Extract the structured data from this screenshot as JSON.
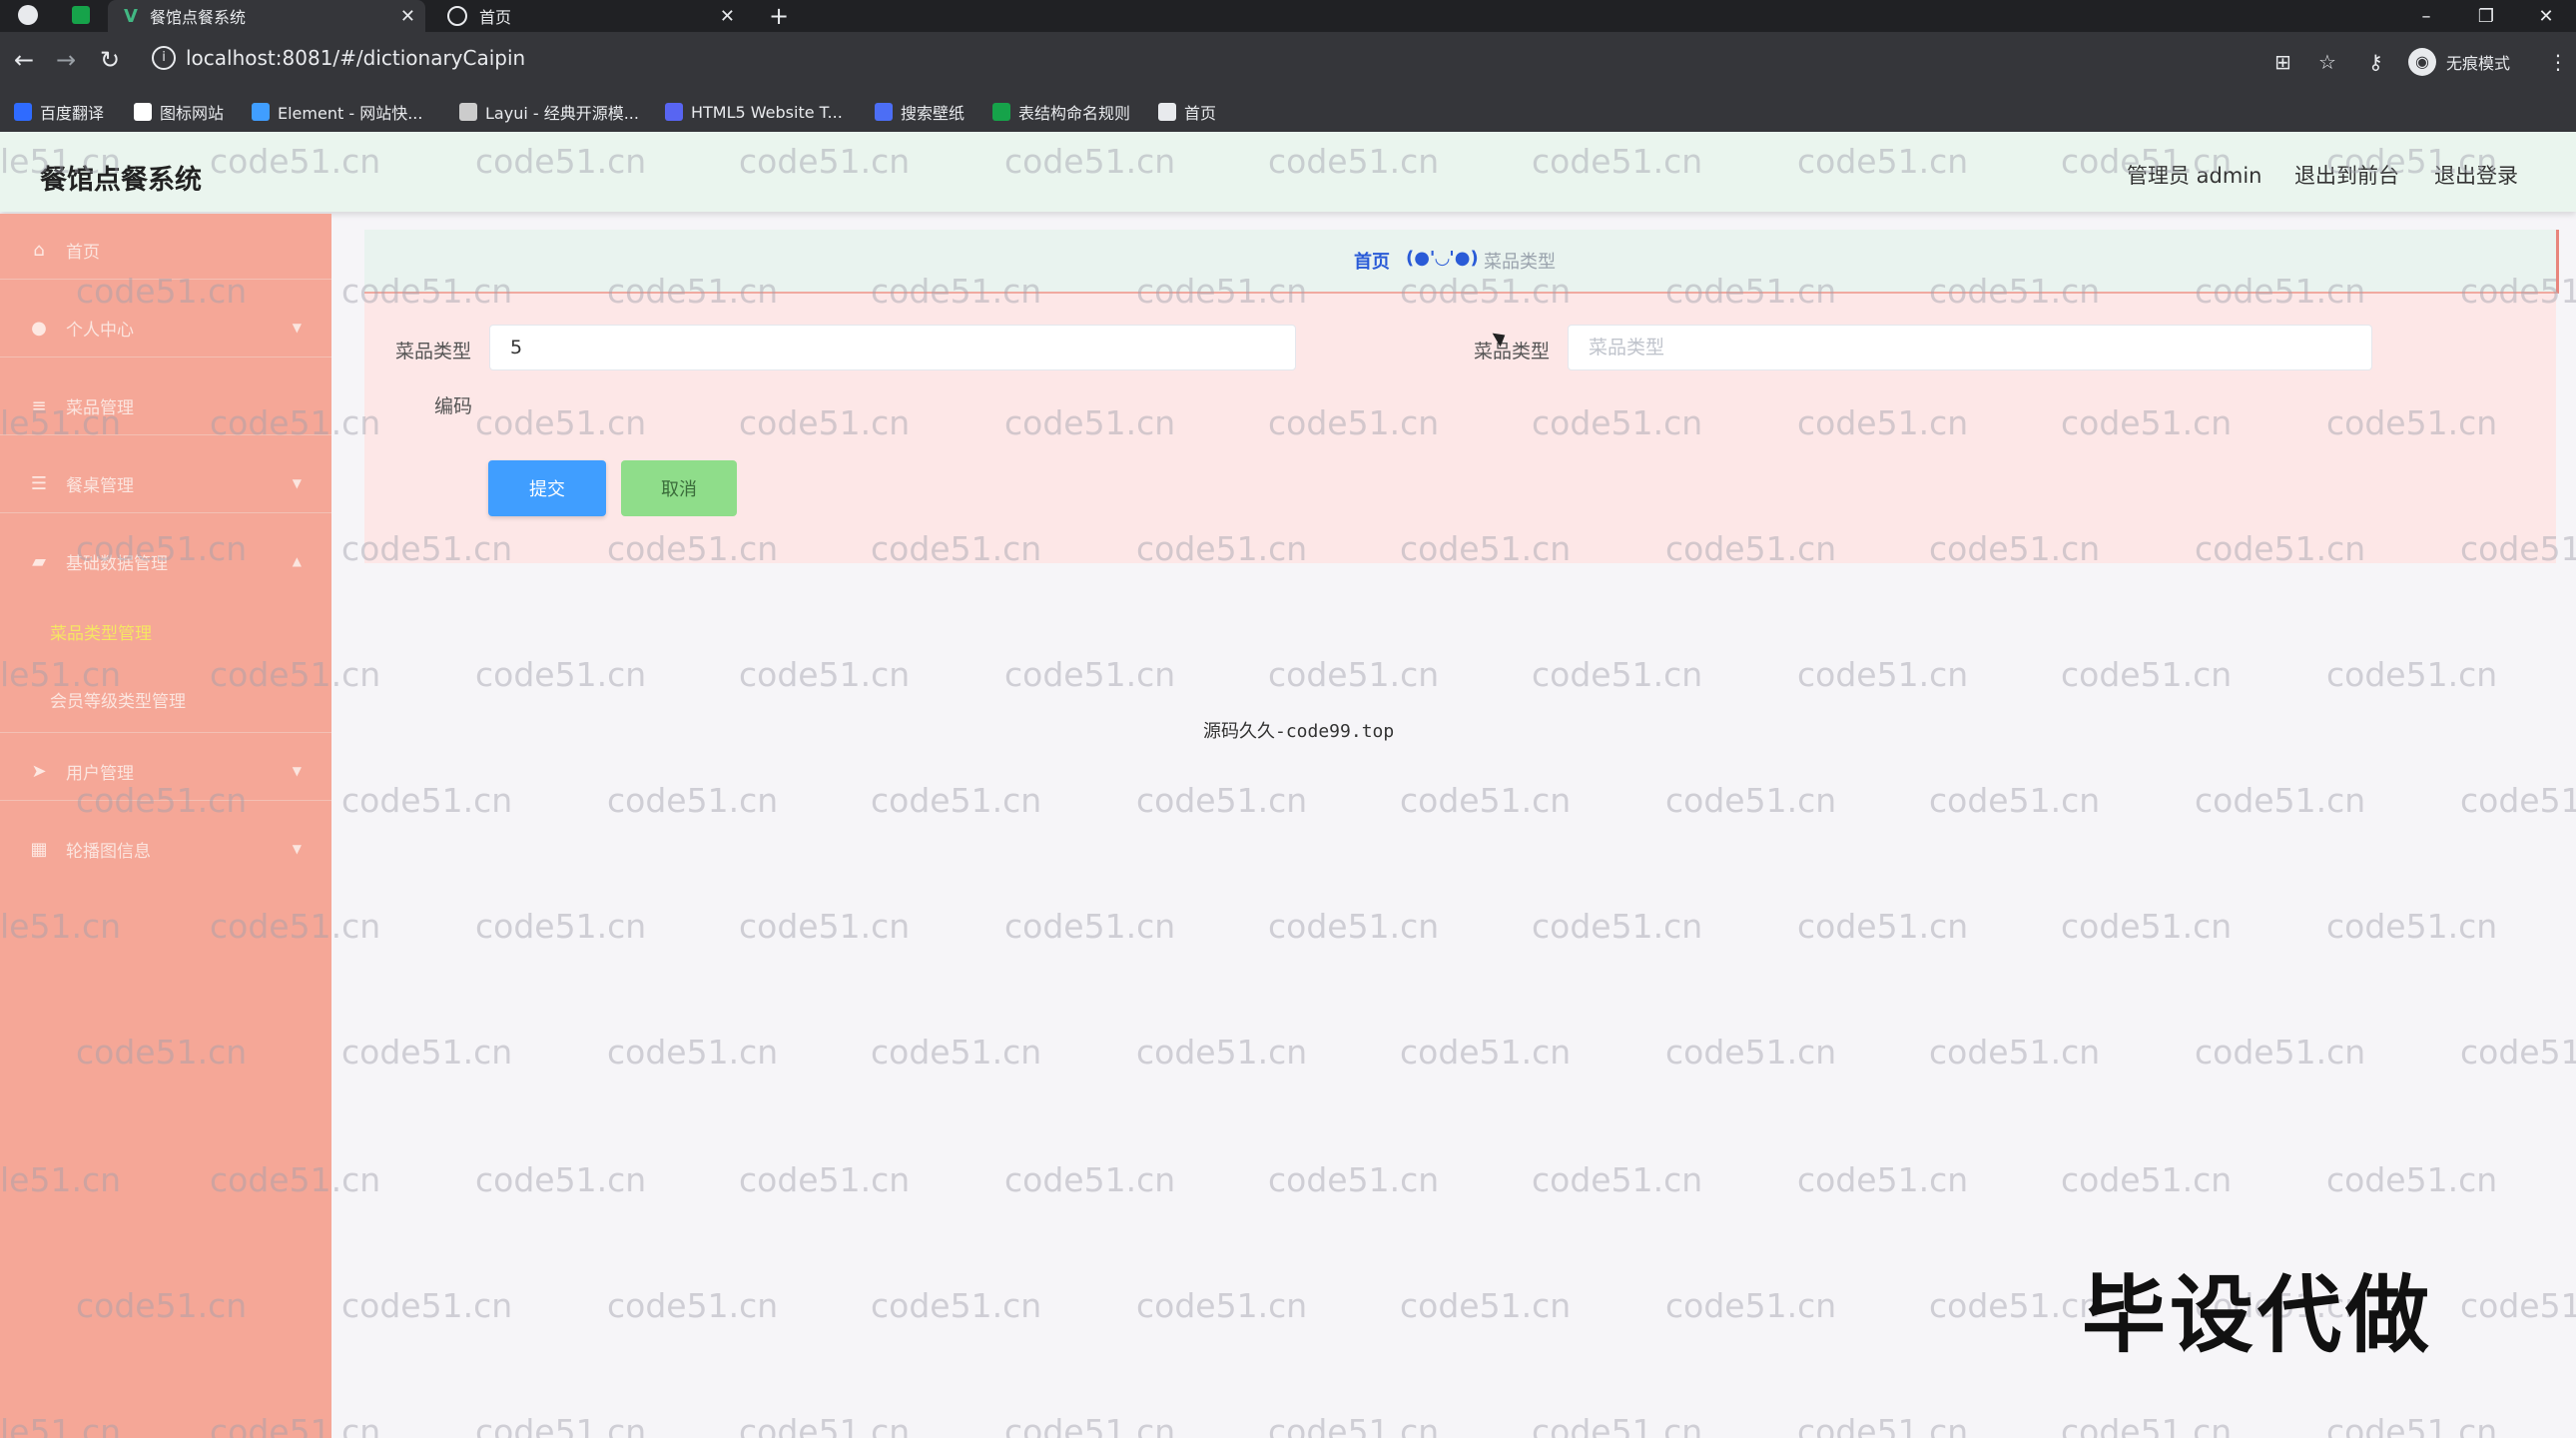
{
  "browser": {
    "tabs": [
      {
        "title": "餐馆点餐系统",
        "active": true
      },
      {
        "title": "首页",
        "active": false
      }
    ],
    "new_tab": "+",
    "url": "localhost:8081/#/dictionaryCaipin",
    "incognito_label": "无痕模式",
    "bookmarks": [
      {
        "label": "百度翻译",
        "color": "#2f6bff"
      },
      {
        "label": "图标网站",
        "color": "#ffffff"
      },
      {
        "label": "Element - 网站快...",
        "color": "#409eff"
      },
      {
        "label": "Layui - 经典开源模...",
        "color": "#cccccc"
      },
      {
        "label": "HTML5 Website T...",
        "color": "#5865f2"
      },
      {
        "label": "搜索壁纸",
        "color": "#4c6ef5"
      },
      {
        "label": "表结构命名规则",
        "color": "#16a34a"
      },
      {
        "label": "首页",
        "color": "#e8eaed"
      }
    ]
  },
  "header": {
    "app_title": "餐馆点餐系统",
    "admin_label": "管理员 admin",
    "to_front": "退出到前台",
    "logout": "退出登录"
  },
  "sidebar": {
    "items": [
      {
        "label": "首页",
        "icon": "home-icon",
        "glyph": "⌂"
      },
      {
        "label": "个人中心",
        "icon": "user-icon",
        "glyph": "●"
      },
      {
        "label": "菜品管理",
        "icon": "list-icon",
        "glyph": "≡"
      },
      {
        "label": "餐桌管理",
        "icon": "menu-icon",
        "glyph": "☰"
      },
      {
        "label": "基础数据管理",
        "icon": "box-icon",
        "glyph": "▰"
      },
      {
        "label": "用户管理",
        "icon": "send-icon",
        "glyph": "➤"
      },
      {
        "label": "轮播图信息",
        "icon": "grid-icon",
        "glyph": "▦"
      }
    ],
    "submenu": [
      {
        "label": "菜品类型管理",
        "active": true
      },
      {
        "label": "会员等级类型管理",
        "active": false
      }
    ]
  },
  "breadcrumb": {
    "home": "首页",
    "separator": "(●'◡'●)",
    "current": "菜品类型"
  },
  "form": {
    "code_label_line1": "菜品类型",
    "code_label_line2": "编码",
    "code_value": "5",
    "type_label": "菜品类型",
    "type_placeholder": "菜品类型",
    "submit": "提交",
    "cancel": "取消"
  },
  "footer_text": "源码久久-code99.top",
  "stamp_text": "毕设代做",
  "watermark": "code51.cn",
  "watermark_edge": "le51.cn",
  "colors": {
    "sidebar": "#f5a797",
    "submenu_active": "#f5e663",
    "submit": "#409eff",
    "cancel": "#8fdd8a",
    "breadcrumb_link": "#2a5bd7"
  }
}
